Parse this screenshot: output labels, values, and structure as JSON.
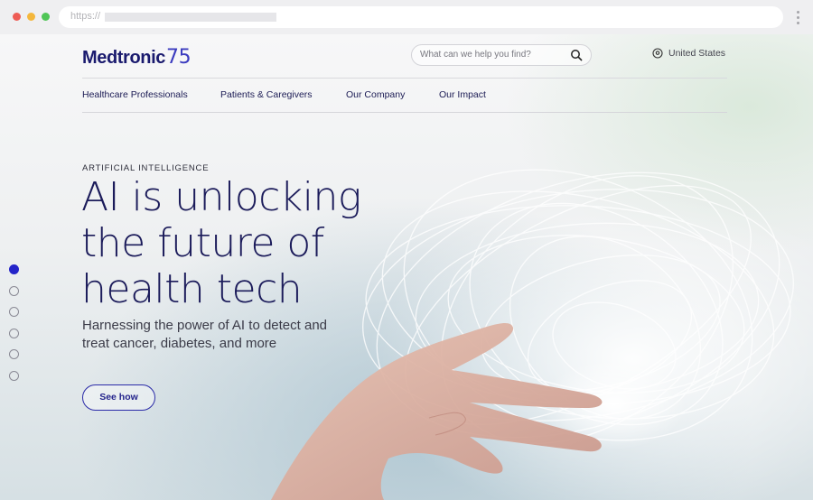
{
  "browser": {
    "url_prefix": "https://"
  },
  "header": {
    "logo_text": "Medtronic",
    "logo_number": "75",
    "search_placeholder": "What can we help you find?",
    "region_label": "United States"
  },
  "nav": {
    "items": [
      {
        "label": "Healthcare Professionals"
      },
      {
        "label": "Patients & Caregivers"
      },
      {
        "label": "Our Company"
      },
      {
        "label": "Our Impact"
      }
    ]
  },
  "hero": {
    "eyebrow": "ARTIFICIAL INTELLIGENCE",
    "headline_line1": "AI is unlocking",
    "headline_line2": "the future of",
    "headline_line3": "health tech",
    "subtitle": "Harnessing the power of AI to detect and treat cancer, diabetes, and more",
    "cta_label": "See how"
  },
  "carousel": {
    "slide_count": 6,
    "active_index": 0
  },
  "colors": {
    "brand_navy": "#1b1b5a",
    "accent_blue": "#2424c9"
  }
}
